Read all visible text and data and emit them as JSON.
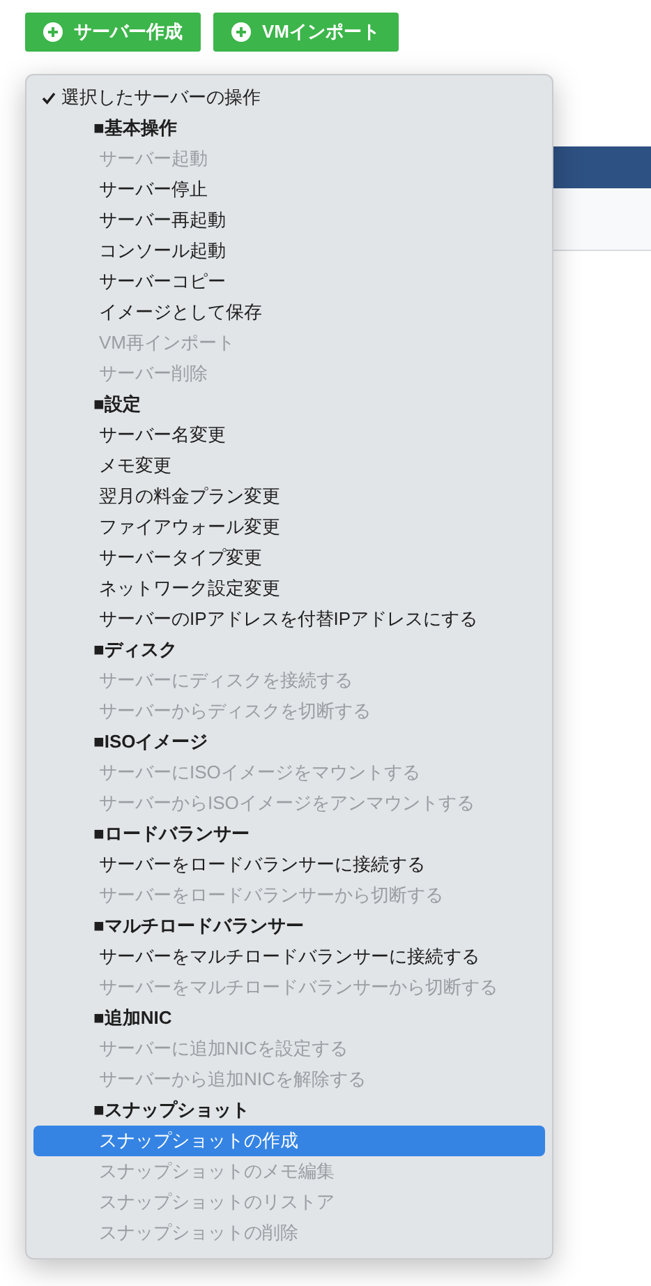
{
  "buttons": [
    {
      "label": "サーバー作成"
    },
    {
      "label": "VMインポート"
    }
  ],
  "menu": {
    "title": {
      "label": "選択したサーバーの操作",
      "checked": true
    },
    "groups": [
      {
        "label": "■基本操作",
        "items": [
          {
            "label": "サーバー起動",
            "disabled": true,
            "selected": false
          },
          {
            "label": "サーバー停止",
            "disabled": false,
            "selected": false
          },
          {
            "label": "サーバー再起動",
            "disabled": false,
            "selected": false
          },
          {
            "label": "コンソール起動",
            "disabled": false,
            "selected": false
          },
          {
            "label": "サーバーコピー",
            "disabled": false,
            "selected": false
          },
          {
            "label": "イメージとして保存",
            "disabled": false,
            "selected": false
          },
          {
            "label": "VM再インポート",
            "disabled": true,
            "selected": false
          },
          {
            "label": "サーバー削除",
            "disabled": true,
            "selected": false
          }
        ]
      },
      {
        "label": "■設定",
        "items": [
          {
            "label": "サーバー名変更",
            "disabled": false,
            "selected": false
          },
          {
            "label": "メモ変更",
            "disabled": false,
            "selected": false
          },
          {
            "label": "翌月の料金プラン変更",
            "disabled": false,
            "selected": false
          },
          {
            "label": "ファイアウォール変更",
            "disabled": false,
            "selected": false
          },
          {
            "label": "サーバータイプ変更",
            "disabled": false,
            "selected": false
          },
          {
            "label": "ネットワーク設定変更",
            "disabled": false,
            "selected": false
          },
          {
            "label": "サーバーのIPアドレスを付替IPアドレスにする",
            "disabled": false,
            "selected": false
          }
        ]
      },
      {
        "label": "■ディスク",
        "items": [
          {
            "label": "サーバーにディスクを接続する",
            "disabled": true,
            "selected": false
          },
          {
            "label": "サーバーからディスクを切断する",
            "disabled": true,
            "selected": false
          }
        ]
      },
      {
        "label": "■ISOイメージ",
        "items": [
          {
            "label": "サーバーにISOイメージをマウントする",
            "disabled": true,
            "selected": false
          },
          {
            "label": "サーバーからISOイメージをアンマウントする",
            "disabled": true,
            "selected": false
          }
        ]
      },
      {
        "label": "■ロードバランサー",
        "items": [
          {
            "label": "サーバーをロードバランサーに接続する",
            "disabled": false,
            "selected": false
          },
          {
            "label": "サーバーをロードバランサーから切断する",
            "disabled": true,
            "selected": false
          }
        ]
      },
      {
        "label": "■マルチロードバランサー",
        "items": [
          {
            "label": "サーバーをマルチロードバランサーに接続する",
            "disabled": false,
            "selected": false
          },
          {
            "label": "サーバーをマルチロードバランサーから切断する",
            "disabled": true,
            "selected": false
          }
        ]
      },
      {
        "label": "■追加NIC",
        "items": [
          {
            "label": "サーバーに追加NICを設定する",
            "disabled": true,
            "selected": false
          },
          {
            "label": "サーバーから追加NICを解除する",
            "disabled": true,
            "selected": false
          }
        ]
      },
      {
        "label": "■スナップショット",
        "items": [
          {
            "label": "スナップショットの作成",
            "disabled": false,
            "selected": true
          },
          {
            "label": "スナップショットのメモ編集",
            "disabled": true,
            "selected": false
          },
          {
            "label": "スナップショットのリストア",
            "disabled": true,
            "selected": false
          },
          {
            "label": "スナップショットの削除",
            "disabled": true,
            "selected": false
          }
        ]
      }
    ]
  }
}
